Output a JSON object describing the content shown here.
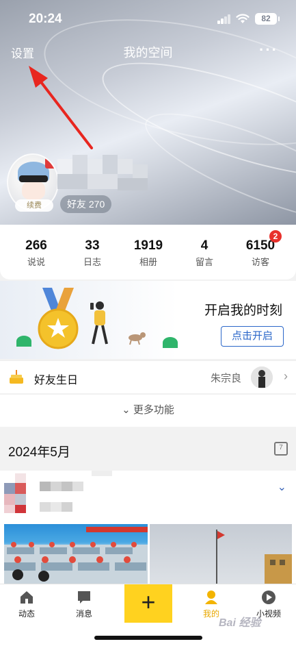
{
  "status_bar": {
    "time": "20:24",
    "battery": "82"
  },
  "nav": {
    "settings": "设置",
    "title": "我的空间",
    "more": "···"
  },
  "profile": {
    "renew_badge": "续费",
    "friends_label": "好友 270"
  },
  "stats": [
    {
      "num": "266",
      "label": "说说"
    },
    {
      "num": "33",
      "label": "日志"
    },
    {
      "num": "1919",
      "label": "相册"
    },
    {
      "num": "4",
      "label": "留言"
    },
    {
      "num": "6150",
      "label": "访客"
    }
  ],
  "visitor_badge": "2",
  "moment": {
    "title": "开启我的时刻",
    "button": "点击开启"
  },
  "birthday": {
    "label": "好友生日",
    "name": "朱宗良"
  },
  "more_features": "更多功能",
  "month": {
    "label": "2024年5月",
    "calendar_day": "7"
  },
  "tabs": [
    {
      "label": "动态",
      "icon": "home-icon"
    },
    {
      "label": "消息",
      "icon": "message-icon"
    },
    {
      "label": "+",
      "icon": "plus-icon"
    },
    {
      "label": "我的",
      "icon": "person-icon"
    },
    {
      "label": "小视频",
      "icon": "play-icon"
    }
  ],
  "watermark": "Bai 经验",
  "colors": {
    "accent_yellow": "#ffd21f",
    "blue": "#2b67c9",
    "badge_red": "#e8312c",
    "arrow_red": "#e8261f"
  }
}
